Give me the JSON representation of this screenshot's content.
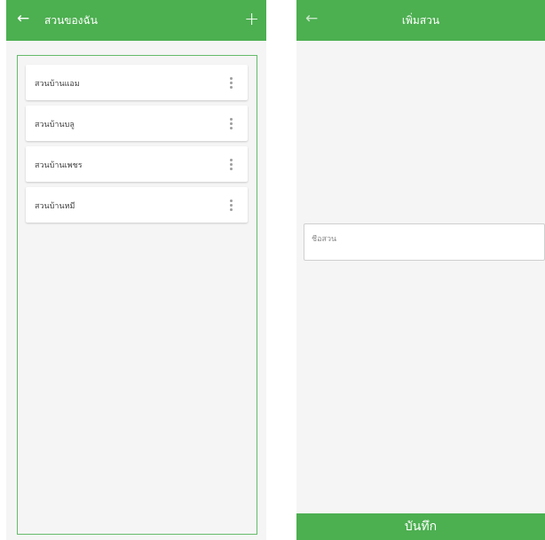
{
  "my_gardens": {
    "title": "สวนของฉัน",
    "back_icon": "arrow-left-icon",
    "add_label": "+",
    "items": [
      {
        "label": "สวนบ้านแอม"
      },
      {
        "label": "สวนบ้านบลู"
      },
      {
        "label": "สวนบ้านเพชร"
      },
      {
        "label": "สวนบ้านหมี"
      }
    ],
    "item_menu_icon": "more-vertical-icon"
  },
  "add_garden": {
    "title": "เพิ่มสวน",
    "back_icon": "arrow-left-icon",
    "name_field": {
      "placeholder": "ชื่อสวน",
      "value": ""
    },
    "save_label": "บันทึก"
  },
  "colors": {
    "primary": "#4caf50",
    "frame_border": "#66bb6a",
    "background": "#f5f5f5"
  }
}
